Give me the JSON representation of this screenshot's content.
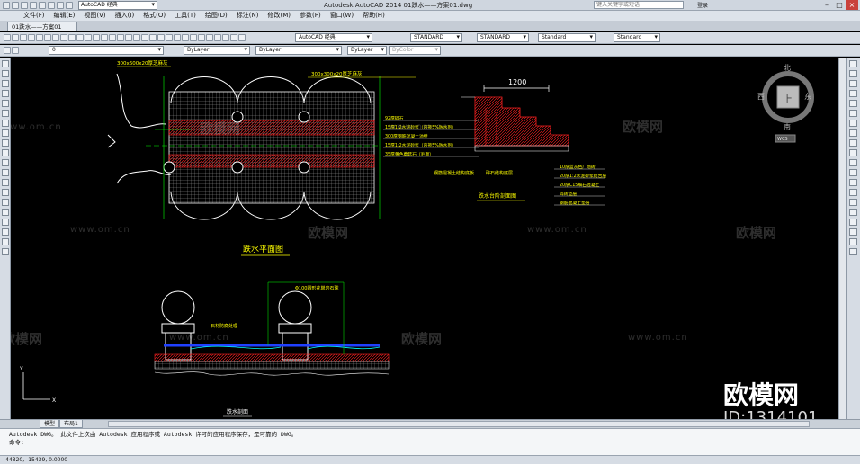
{
  "titlebar": {
    "workspace": "AutoCAD 经典",
    "title": "Autodesk AutoCAD 2014    01跌水——方案01.dwg",
    "search_placeholder": "键入关键字或短语",
    "login": "登录"
  },
  "menu": [
    "文件(F)",
    "编辑(E)",
    "视图(V)",
    "插入(I)",
    "格式(O)",
    "工具(T)",
    "绘图(D)",
    "标注(N)",
    "修改(M)",
    "参数(P)",
    "窗口(W)",
    "帮助(H)"
  ],
  "doc_tab": "01跌水——方案01",
  "toolbar1": {
    "workspace": "AutoCAD 经典",
    "text_style": "STANDARD",
    "dim_style": "STANDARD",
    "table_style": "Standard",
    "ml_style": "Standard"
  },
  "toolbar2": {
    "layer": "0",
    "color": "ByLayer",
    "linetype": "ByLayer",
    "lineweight": "ByLayer",
    "plotstyle": "ByColor"
  },
  "drawing": {
    "plan_title": "跌水平面图",
    "section_title": "跌水台阶剖面图",
    "dim_1200": "1200",
    "plan_dim_top": "300x600x20厚芝麻灰",
    "plan_dim_right": "300x300x20厚芝麻灰",
    "section_notes_left": [
      "92厚碎石",
      "15厚1:2水泥砂浆（内掺5%防水剂）",
      "300厚钢筋混凝土池壁",
      "15厚1:2水泥砂浆（内掺5%防水剂）",
      "35厚黄色蘑菇石（毛面）"
    ],
    "section_notes_right": [
      "10厚蓝灰色广场砖",
      "20厚1:2水泥砂浆结合层",
      "20厚C15细石混凝土",
      "碎砖垫层",
      "钢筋混凝土垫层"
    ],
    "section_note_bottom": [
      "钢筋混凝土结构底板",
      "碎石结构底层"
    ],
    "elevation_note": "石材防腐处理",
    "elevation_dim": "Φ100圆形花岗岩石球",
    "bottom_label": "跌水剖面"
  },
  "compass": {
    "north": "北",
    "south": "南",
    "east": "东",
    "west": "西",
    "center": "上",
    "wcs": "WCS"
  },
  "layout_tabs": [
    "模型",
    "布局1"
  ],
  "command_lines": [
    "Autodesk DWG。  此文件上次由 Autodesk 应用程序或 Autodesk 许可的应用程序保存，是可靠的 DWG。",
    "命令:"
  ],
  "status_coords": "-44320, -15439, 0.0000",
  "watermarks": {
    "url": "www.om.cn",
    "logo": "欧模网",
    "big_logo": "欧模网",
    "id_text": "ID:1314101"
  },
  "colors": {
    "canvas": "#000000",
    "cad_white": "#ffffff",
    "cad_yellow": "#ffff00",
    "cad_red": "#ff2020",
    "cad_green": "#00ff00",
    "cad_blue": "#2040ff",
    "cad_cyan": "#00ffff"
  }
}
